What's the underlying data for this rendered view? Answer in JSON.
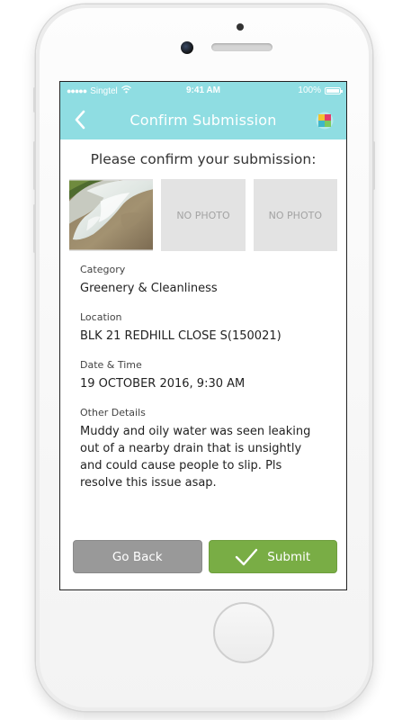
{
  "status_bar": {
    "carrier": "Singtel",
    "time": "9:41 AM",
    "battery": "100%",
    "signal_dots": "●●●●●"
  },
  "nav": {
    "title": "Confirm Submission",
    "back_icon": "chevron-left-icon",
    "logo_icon": "app-logo-icon"
  },
  "heading": "Please confirm your submission:",
  "photos": [
    {
      "type": "image",
      "label": ""
    },
    {
      "type": "placeholder",
      "label": "NO PHOTO"
    },
    {
      "type": "placeholder",
      "label": "NO PHOTO"
    }
  ],
  "details": {
    "category_label": "Category",
    "category_value": "Greenery & Cleanliness",
    "location_label": "Location",
    "location_value": "BLK 21 REDHILL CLOSE S(150021)",
    "datetime_label": "Date & Time",
    "datetime_value": "19 OCTOBER 2016, 9:30 AM",
    "other_label": "Other Details",
    "other_value": "Muddy and oily water was seen leaking out of a nearby drain that is unsightly and could cause people to slip. Pls resolve this issue asap."
  },
  "actions": {
    "back_label": "Go Back",
    "submit_label": "Submit"
  },
  "colors": {
    "header": "#8fdde2",
    "submit": "#79ad45",
    "back": "#999999",
    "placeholder": "#e3e3e3"
  }
}
